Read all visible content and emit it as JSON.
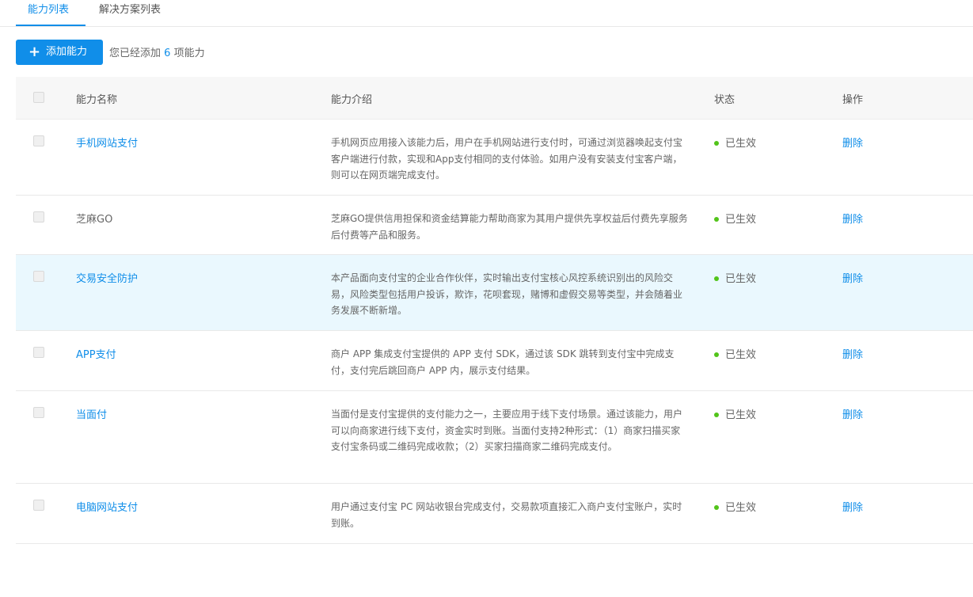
{
  "tabs": {
    "ability_list": "能力列表",
    "solution_list": "解决方案列表"
  },
  "toolbar": {
    "add_button_icon": "+",
    "add_button_label": "添加能力",
    "count_prefix": "您已经添加",
    "count_value": "6",
    "count_suffix": "项能力"
  },
  "table": {
    "headers": {
      "name": "能力名称",
      "desc": "能力介绍",
      "status": "状态",
      "op": "操作"
    },
    "rows": [
      {
        "name": "手机网站支付",
        "desc": "手机网页应用接入该能力后，用户在手机网站进行支付时，可通过浏览器唤起支付宝客户端进行付款，实现和App支付相同的支付体验。如用户没有安装支付宝客户端，则可以在网页端完成支付。",
        "status": "已生效",
        "op": "删除"
      },
      {
        "name": "芝麻GO",
        "desc": "芝麻GO提供信用担保和资金结算能力帮助商家为其用户提供先享权益后付费先享服务后付费等产品和服务。",
        "status": "已生效",
        "op": "删除"
      },
      {
        "name": "交易安全防护",
        "desc": "本产品面向支付宝的企业合作伙伴，实时输出支付宝核心风控系统识别出的风险交易，风险类型包括用户投诉，欺诈，花呗套现，赌博和虚假交易等类型，并会随着业务发展不断新增。",
        "status": "已生效",
        "op": "删除"
      },
      {
        "name": "APP支付",
        "desc": "商户 APP 集成支付宝提供的 APP 支付 SDK，通过该 SDK 跳转到支付宝中完成支付，支付完后跳回商户 APP 内，展示支付结果。",
        "status": "已生效",
        "op": "删除"
      },
      {
        "name": "当面付",
        "desc": "当面付是支付宝提供的支付能力之一，主要应用于线下支付场景。通过该能力，用户可以向商家进行线下支付，资金实时到账。当面付支持2种形式：（1）商家扫描买家支付宝条码或二维码完成收款；（2）买家扫描商家二维码完成支付。",
        "status": "已生效",
        "op": "删除"
      },
      {
        "name": "电脑网站支付",
        "desc": "用户通过支付宝 PC 网站收银台完成支付，交易款项直接汇入商户支付宝账户，实时到账。",
        "status": "已生效",
        "op": "删除"
      }
    ]
  },
  "colors": {
    "primary": "#108ee9",
    "status_active": "#52c41a",
    "highlight_row": "#eaf8fe",
    "header_bg": "#f7f7f7"
  }
}
